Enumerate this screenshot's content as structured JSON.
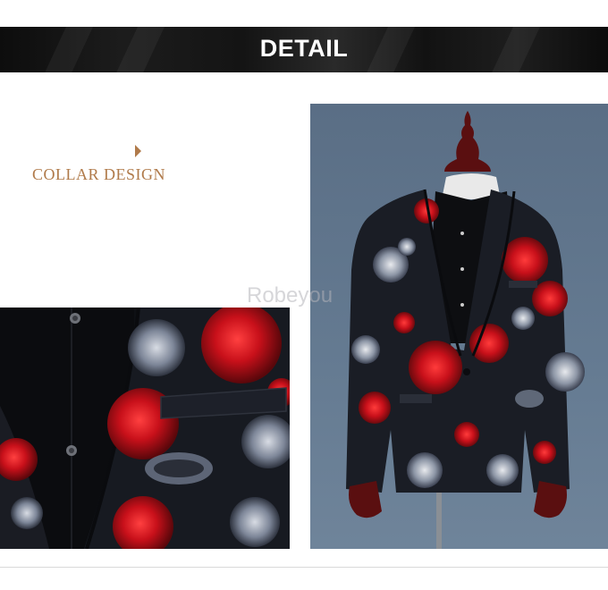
{
  "banner": {
    "title": "DETAIL"
  },
  "section": {
    "label": "COLLAR DESIGN"
  },
  "watermark": {
    "text": "Robeyou"
  },
  "colors": {
    "accent": "#b07a4a",
    "banner_bg": "#111111",
    "rose_red": "#c8101a",
    "backdrop": "#6a7f95"
  },
  "icons": {
    "section_marker": "caret-right-icon"
  }
}
